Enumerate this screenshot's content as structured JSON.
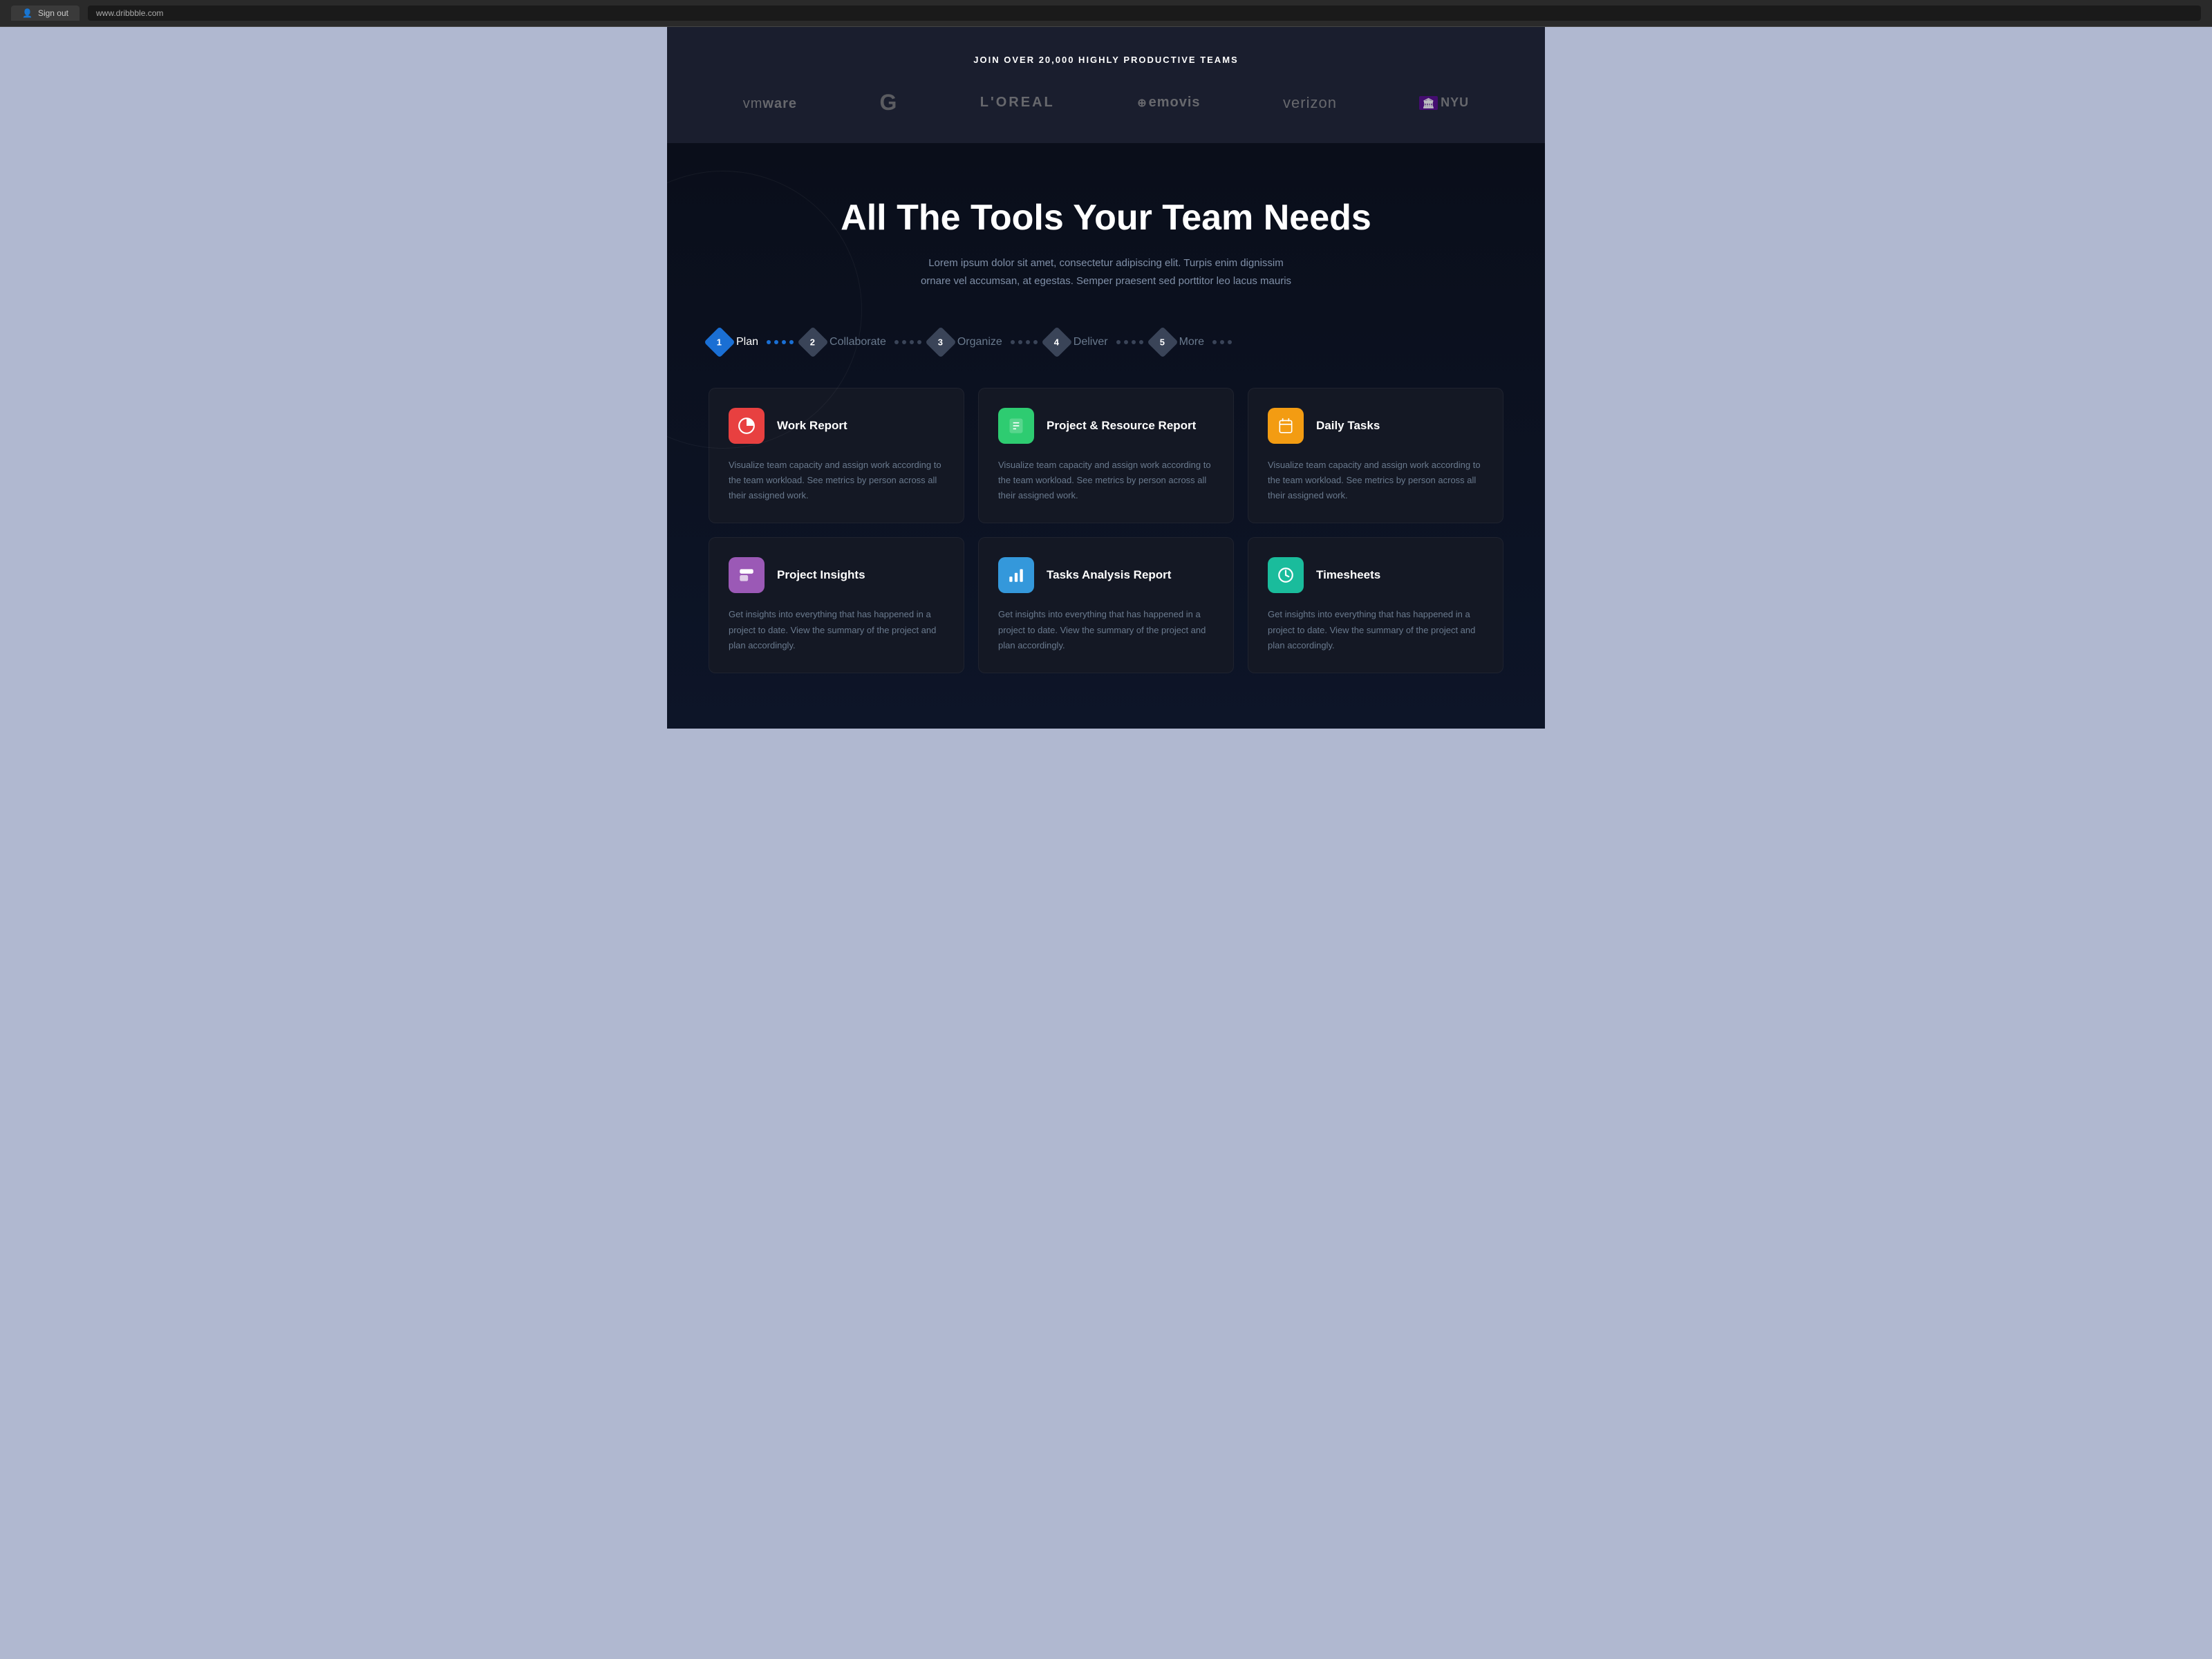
{
  "browser": {
    "tab_label": "Sign out",
    "url": "www.dribbble.com"
  },
  "logos_section": {
    "tagline": "JOIN OVER 20,000 HIGHLY PRODUCTIVE TEAMS",
    "logos": [
      {
        "id": "vmware",
        "label": "vmware",
        "prefix": "vm",
        "suffix": "ware"
      },
      {
        "id": "google",
        "label": "G"
      },
      {
        "id": "loreal",
        "label": "L'OREAL"
      },
      {
        "id": "emovis",
        "label": "emovis"
      },
      {
        "id": "verizon",
        "label": "verizon"
      },
      {
        "id": "nyu",
        "label": "NYU"
      }
    ]
  },
  "tools_section": {
    "title": "All The Tools Your Team Needs",
    "subtitle": "Lorem ipsum dolor sit amet, consectetur adipiscing elit. Turpis enim dignissim ornare vel accumsan, at egestas. Semper praesent sed porttitor leo lacus mauris",
    "steps": [
      {
        "id": "plan",
        "number": "1",
        "label": "Plan",
        "active": true
      },
      {
        "id": "collaborate",
        "number": "2",
        "label": "Collaborate",
        "active": false
      },
      {
        "id": "organize",
        "number": "3",
        "label": "Organize",
        "active": false
      },
      {
        "id": "deliver",
        "number": "4",
        "label": "Deliver",
        "active": false
      },
      {
        "id": "more",
        "number": "5",
        "label": "More",
        "active": false
      }
    ]
  },
  "cards": [
    {
      "id": "work-report",
      "title": "Work Report",
      "icon": "📊",
      "icon_class": "icon-red",
      "description": "Visualize team capacity and assign work according to the team workload. See metrics by person across all their assigned work."
    },
    {
      "id": "project-resource-report",
      "title": "Project & Resource Report",
      "icon": "📋",
      "icon_class": "icon-green",
      "description": "Visualize team capacity and assign work according to the team workload. See metrics by person across all their assigned work."
    },
    {
      "id": "daily-tasks",
      "title": "Daily Tasks",
      "icon": "📅",
      "icon_class": "icon-orange",
      "description": "Visualize team capacity and assign work according to the team workload. See metrics by person across all their assigned work."
    },
    {
      "id": "project-insights",
      "title": "Project Insights",
      "icon": "📁",
      "icon_class": "icon-purple",
      "description": "Get insights into everything that has happened in a project to date. View the summary of the project and plan accordingly."
    },
    {
      "id": "tasks-analysis-report",
      "title": "Tasks Analysis Report",
      "icon": "📈",
      "icon_class": "icon-blue",
      "description": "Get insights into everything that has happened in a project to date. View the summary of the project and plan accordingly."
    },
    {
      "id": "timesheets",
      "title": "Timesheets",
      "icon": "🕐",
      "icon_class": "icon-teal",
      "description": "Get insights into everything that has happened in a project to date. View the summary of the project and plan accordingly."
    }
  ]
}
